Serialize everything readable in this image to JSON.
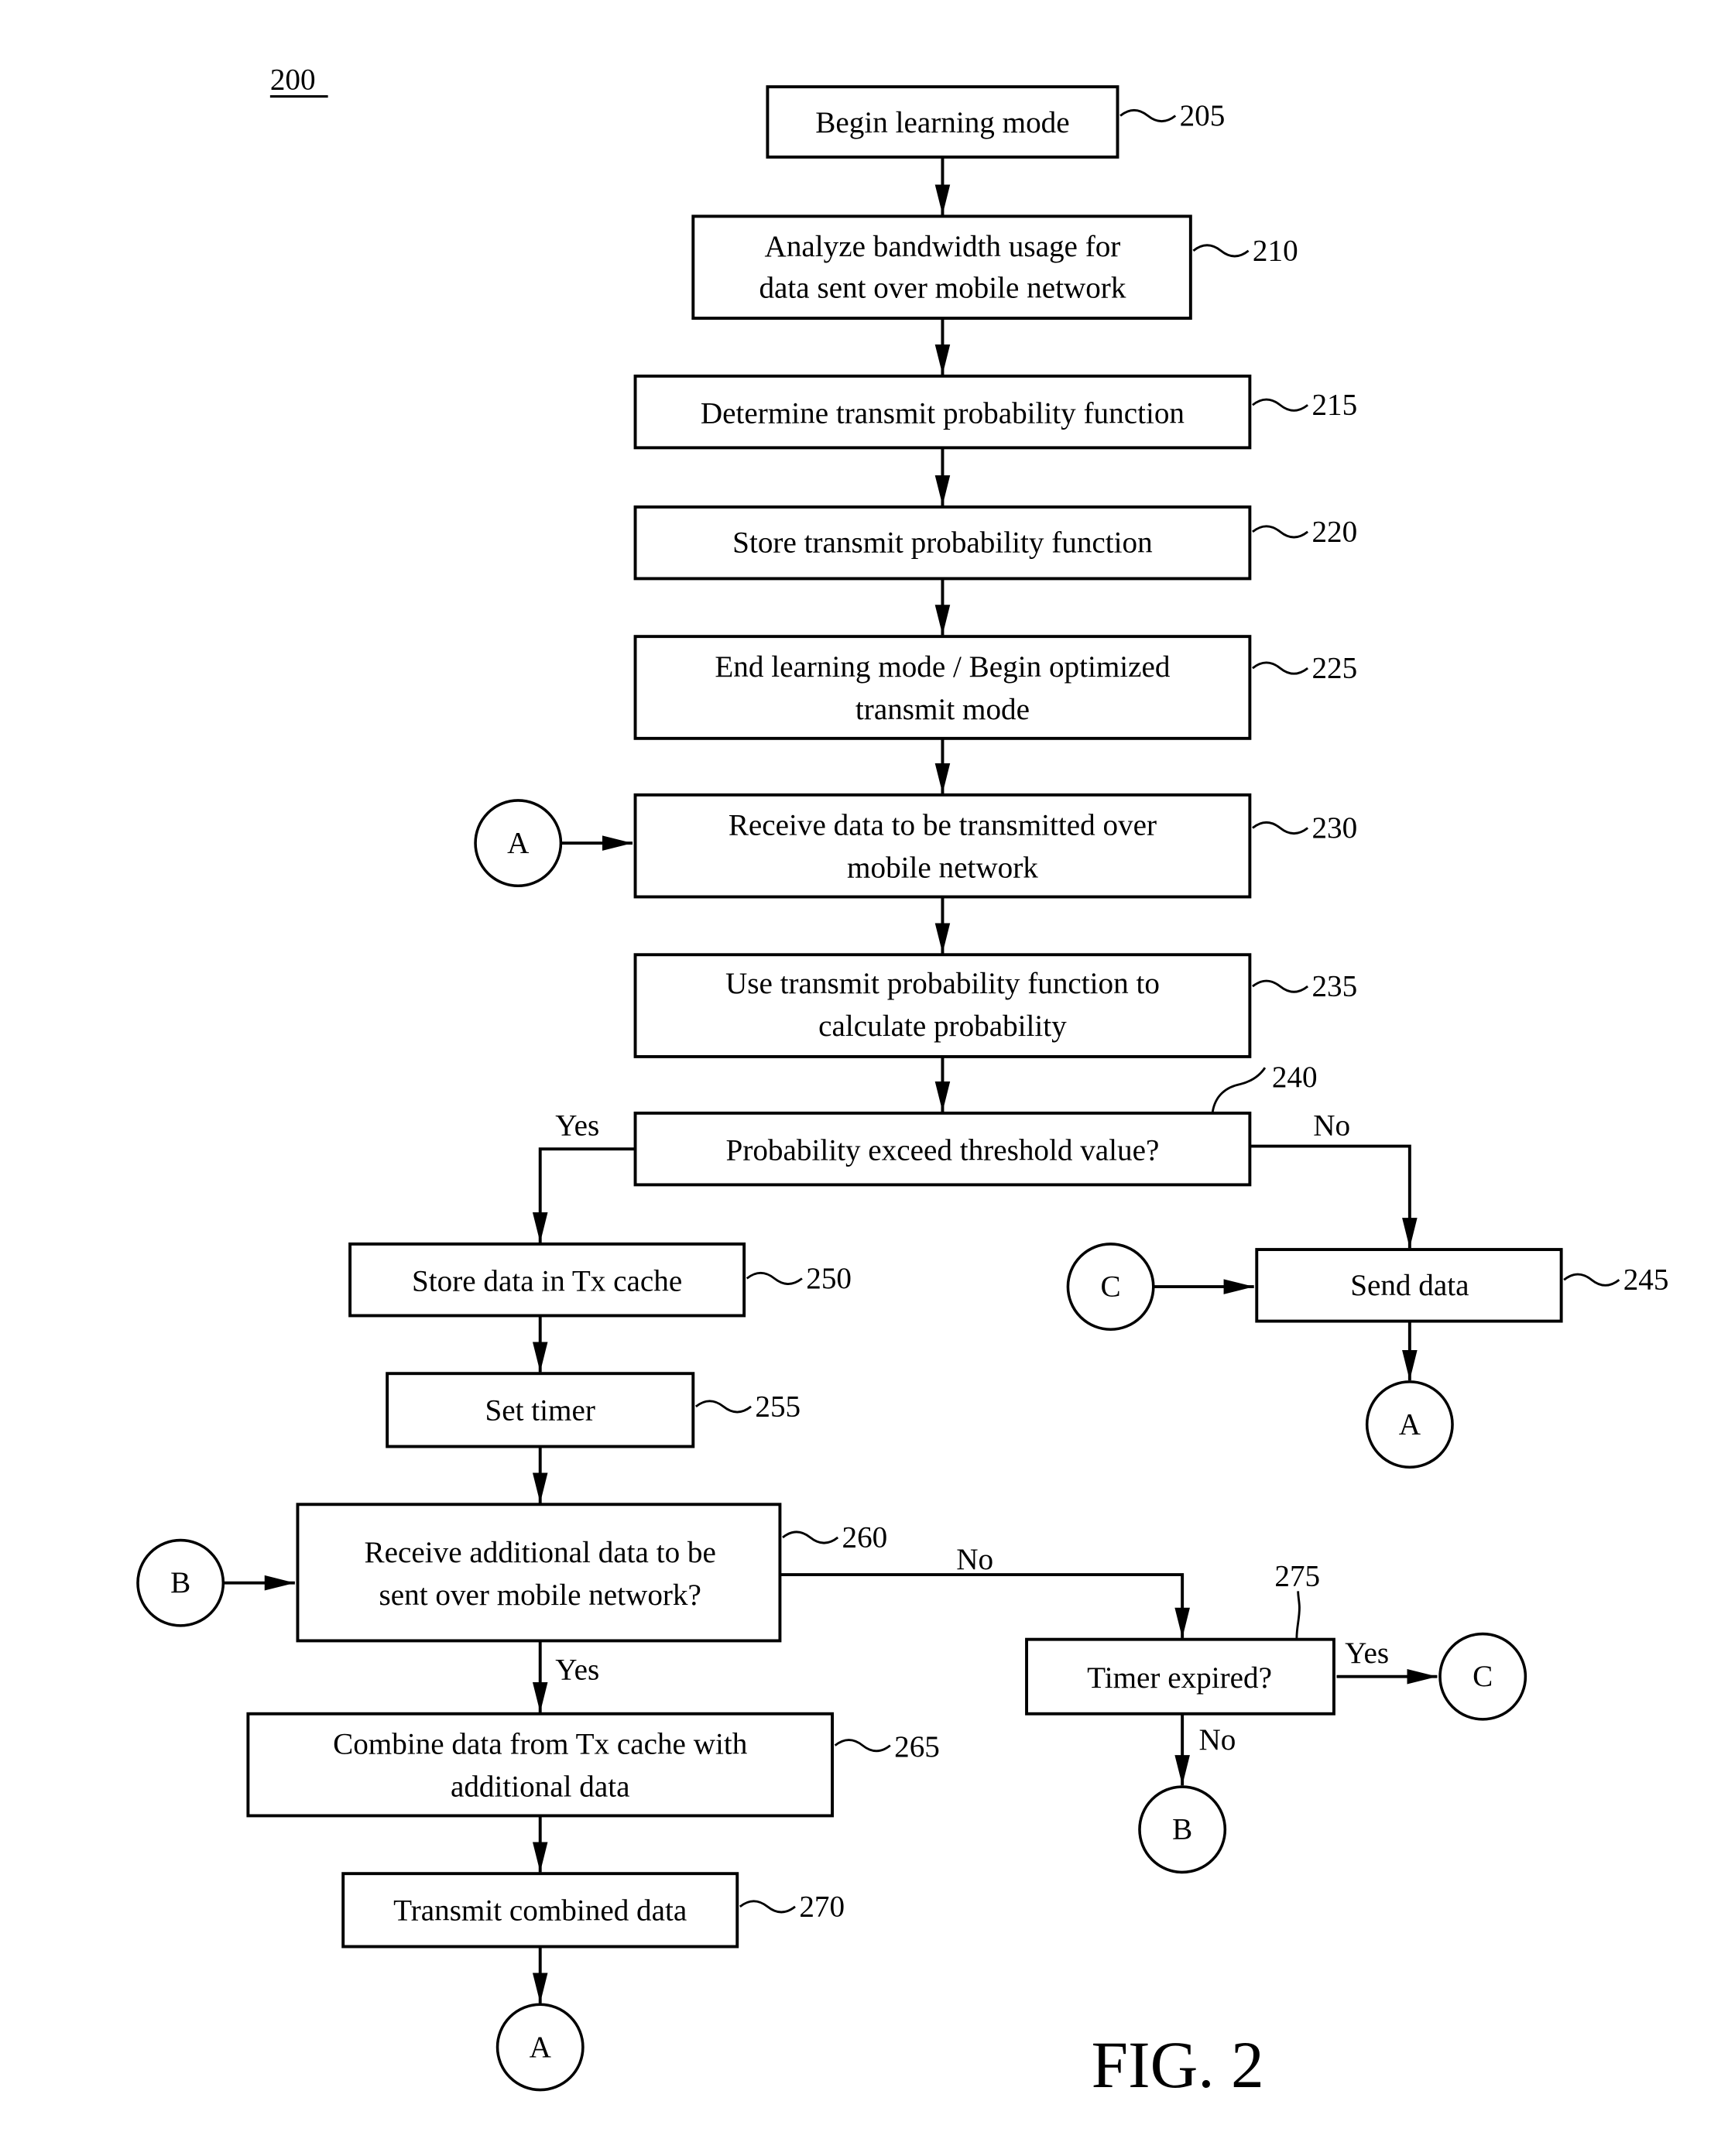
{
  "figure": {
    "number_label": "200",
    "caption": "FIG. 2"
  },
  "steps": {
    "s205": {
      "ref": "205",
      "lines": [
        "Begin learning mode"
      ]
    },
    "s210": {
      "ref": "210",
      "lines": [
        "Analyze bandwidth usage for",
        "data sent over mobile network"
      ]
    },
    "s215": {
      "ref": "215",
      "lines": [
        "Determine transmit probability function"
      ]
    },
    "s220": {
      "ref": "220",
      "lines": [
        "Store transmit probability function"
      ]
    },
    "s225": {
      "ref": "225",
      "lines": [
        "End learning mode / Begin optimized",
        "transmit mode"
      ]
    },
    "s230": {
      "ref": "230",
      "lines": [
        "Receive data to be transmitted over",
        "mobile network"
      ]
    },
    "s235": {
      "ref": "235",
      "lines": [
        "Use transmit probability function to",
        "calculate probability"
      ]
    },
    "s240": {
      "ref": "240",
      "lines": [
        "Probability exceed threshold value?"
      ]
    },
    "s245": {
      "ref": "245",
      "lines": [
        "Send data"
      ]
    },
    "s250": {
      "ref": "250",
      "lines": [
        "Store data in Tx cache"
      ]
    },
    "s255": {
      "ref": "255",
      "lines": [
        "Set timer"
      ]
    },
    "s260": {
      "ref": "260",
      "lines": [
        "Receive additional data to be",
        "sent over mobile network?"
      ]
    },
    "s265": {
      "ref": "265",
      "lines": [
        "Combine data from Tx cache with",
        "additional data"
      ]
    },
    "s270": {
      "ref": "270",
      "lines": [
        "Transmit combined data"
      ]
    },
    "s275": {
      "ref": "275",
      "lines": [
        "Timer expired?"
      ]
    }
  },
  "branch_labels": {
    "s240_yes": "Yes",
    "s240_no": "No",
    "s260_yes": "Yes",
    "s260_no": "No",
    "s275_yes": "Yes",
    "s275_no": "No"
  },
  "connectors": {
    "a_into_230": "A",
    "c_into_245": "C",
    "a_after_245": "A",
    "b_into_260": "B",
    "c_after_275": "C",
    "b_after_275": "B",
    "a_after_270": "A"
  }
}
